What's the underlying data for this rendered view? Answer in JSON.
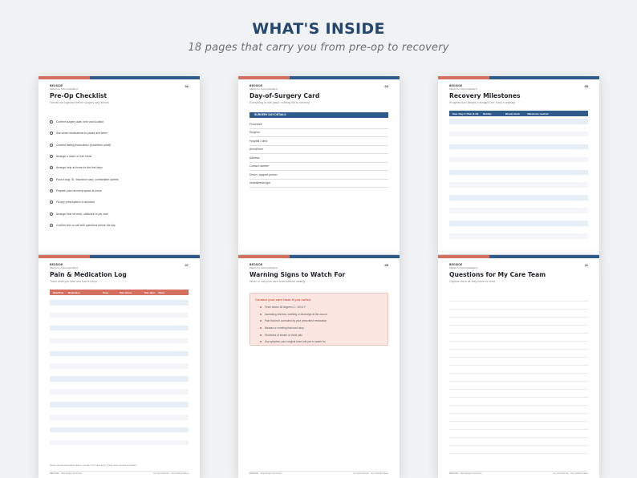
{
  "header": {
    "title": "WHAT'S INSIDE",
    "subtitle": "18 pages that carry you from pre-op to recovery"
  },
  "colors": {
    "brand_blue": "#2f5b8d",
    "brand_coral": "#d3705f",
    "title_blue": "#25476e"
  },
  "pages": {
    "preop": {
      "brand": "BEDSIDE",
      "brand_sub": "MEDICAL MANAGEMENT",
      "number": "02",
      "title": "Pre-Op Checklist",
      "subtitle": "Handle the logistics before surgery day arrives",
      "items": [
        "Confirm surgery date, time and location",
        "Ask which medications to pause and when",
        "Confirm fasting instructions (food/drink cutoff)",
        "Arrange a driver or ride home",
        "Arrange help at home for the first days",
        "Pack a bag: ID, insurance card, comfortable clothes",
        "Prepare your recovery space at home",
        "Fill any prescriptions in advance",
        "Arrange time off work, childcare or pet care",
        "Confirm who to call with questions before the day"
      ]
    },
    "surgerycard": {
      "brand": "BEDSIDE",
      "brand_sub": "MEDICAL MANAGEMENT",
      "number": "04",
      "title": "Day-of-Surgery Card",
      "subtitle": "Everything in one place: nothing left to memory",
      "section": "SURGERY DAY DETAILS",
      "fields": [
        "Procedure",
        "Surgeon",
        "Hospital / clinic",
        "Arrival time",
        "Address",
        "Contact number",
        "Driver / support person",
        "Anaesthesia type"
      ]
    },
    "milestones": {
      "brand": "BEDSIDE",
      "brand_sub": "MEDICAL MANAGEMENT",
      "number": "05",
      "title": "Recovery Milestones",
      "subtitle": "Progress isn't always a straight line: track it anyway",
      "columns": [
        "Date / Day # / Pain (1-10)",
        "Mobility",
        "Wound check",
        "Milestones reached"
      ]
    },
    "painlog": {
      "brand": "BEDSIDE",
      "brand_sub": "MEDICAL MANAGEMENT",
      "number": "07",
      "title": "Pain & Medication Log",
      "subtitle": "Track what you take and how it helps",
      "columns": [
        "Date/Time",
        "Medication",
        "Dose",
        "Pain before",
        "Pain after",
        "Notes"
      ],
      "note": "Never exceed prescribed doses. Contact your care team if pain does not feel controlled.",
      "footer_left": "BEDSIDE · Post-Surgery Recovery",
      "footer_right": "For personal use · Not medical advice"
    },
    "warnings": {
      "brand": "BEDSIDE",
      "brand_sub": "MEDICAL MANAGEMENT",
      "number": "09",
      "title": "Warning Signs to Watch For",
      "subtitle": "When to call your care team without waiting",
      "box_title": "Contact your care team if you notice:",
      "items": [
        "Fever above 38 degrees C / 100.4 F",
        "Increasing redness, swelling or discharge at the wound",
        "Pain that isn't controlled by your prescribed medication",
        "Nausea or vomiting that won't stop",
        "Shortness of breath or chest pain",
        "Any symptom your surgical team told you to watch for"
      ],
      "footer_left": "BEDSIDE · Post-Surgery Recovery",
      "footer_right": "For personal use · Not medical advice"
    },
    "questions": {
      "brand": "BEDSIDE",
      "brand_sub": "MEDICAL MANAGEMENT",
      "number": "11",
      "title": "Questions for My Care Team",
      "subtitle": "Capture them as they come to mind",
      "footer_left": "BEDSIDE · Post-Surgery Recovery",
      "footer_right": "For personal use · Not medical advice"
    }
  }
}
